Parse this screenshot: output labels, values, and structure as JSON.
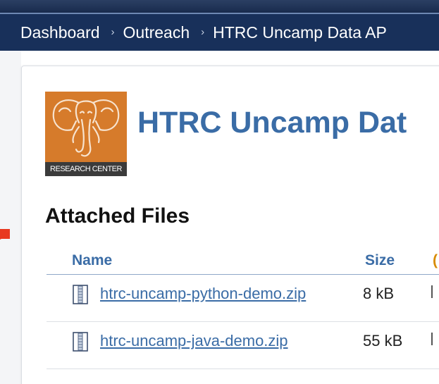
{
  "breadcrumb": {
    "items": [
      "Dashboard",
      "Outreach",
      "HTRC Uncamp Data AP"
    ],
    "separator": "›"
  },
  "logo": {
    "label": "RESEARCH CENTER",
    "color": "#d67b2b",
    "icon": "elephant-icon"
  },
  "page": {
    "title": "HTRC Uncamp Dat"
  },
  "attachments": {
    "heading": "Attached Files",
    "columns": {
      "name": "Name",
      "size": "Size"
    },
    "files": [
      {
        "name": "htrc-uncamp-python-demo.zip",
        "size": "8 kB",
        "icon": "zip-file-icon"
      },
      {
        "name": "htrc-uncamp-java-demo.zip",
        "size": "55 kB",
        "icon": "zip-file-icon"
      }
    ]
  },
  "colors": {
    "nav_background": "#18305a",
    "link": "#3a6ca6",
    "highlight_arrow": "#e8381f"
  }
}
